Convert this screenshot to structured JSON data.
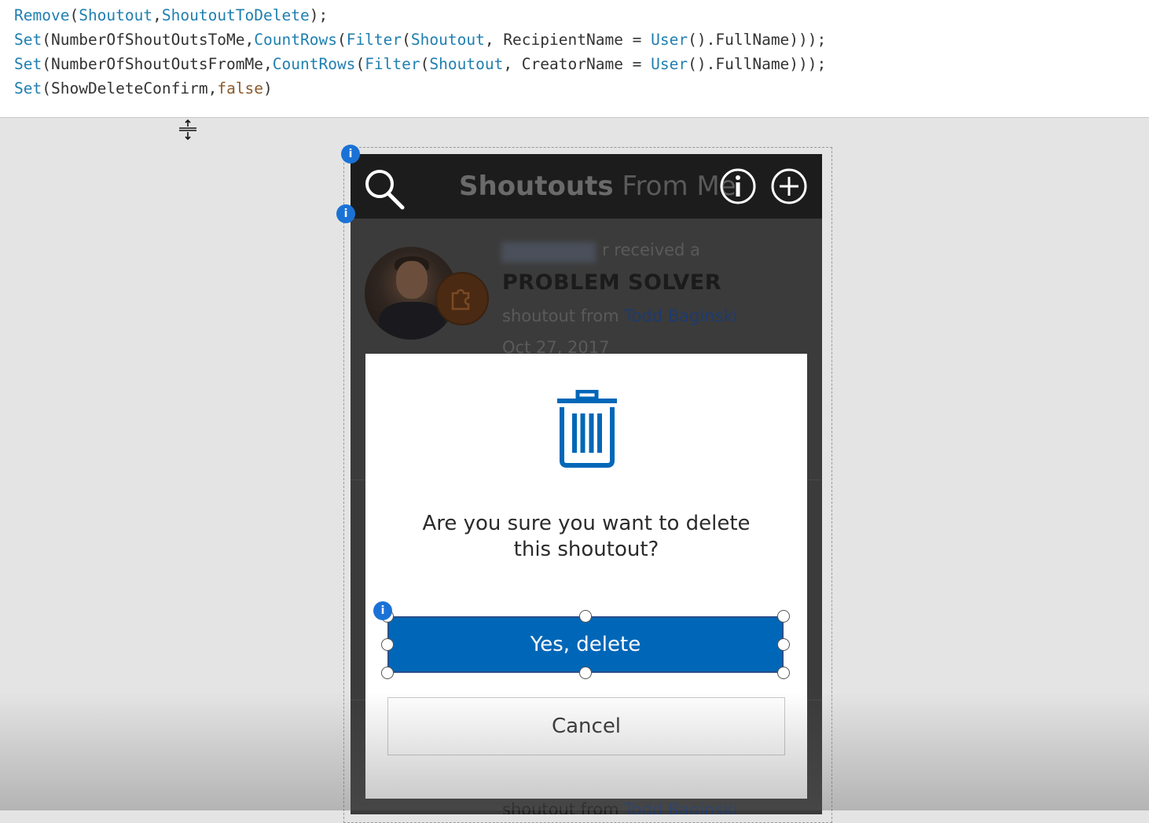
{
  "formula": {
    "line1": {
      "fn": "Remove",
      "args": [
        "Shoutout",
        "ShoutoutToDelete"
      ]
    },
    "line2": {
      "fn": "Set",
      "var": "NumberOfShoutOutsToMe",
      "count": "CountRows",
      "filter": "Filter",
      "table": "Shoutout",
      "field": "RecipientName",
      "user": "User",
      "prop": "FullName"
    },
    "line3": {
      "fn": "Set",
      "var": "NumberOfShoutOutsFromMe",
      "count": "CountRows",
      "filter": "Filter",
      "table": "Shoutout",
      "field": "CreatorName",
      "user": "User",
      "prop": "FullName"
    },
    "line4": {
      "fn": "Set",
      "var": "ShowDeleteConfirm",
      "value": "false"
    }
  },
  "app": {
    "header": {
      "title_bold": "Shoutouts",
      "title_rest": " From Me"
    },
    "item": {
      "received": "r received a",
      "award": "PROBLEM SOLVER",
      "from_prefix": "shoutout from ",
      "from_name": "Todd Baginski",
      "date": "Oct 27, 2017"
    },
    "bottom_item": {
      "from_prefix": "shoutout from ",
      "from_name": "Todd Baginski"
    }
  },
  "dialog": {
    "message": "Are you sure you want to delete this shoutout?",
    "confirm_label": "Yes, delete",
    "cancel_label": "Cancel"
  },
  "designer": {
    "badge_label": "i"
  },
  "colors": {
    "accent": "#0067b8",
    "header": "#1c1c1c",
    "code_fn": "#1f7fb0"
  }
}
